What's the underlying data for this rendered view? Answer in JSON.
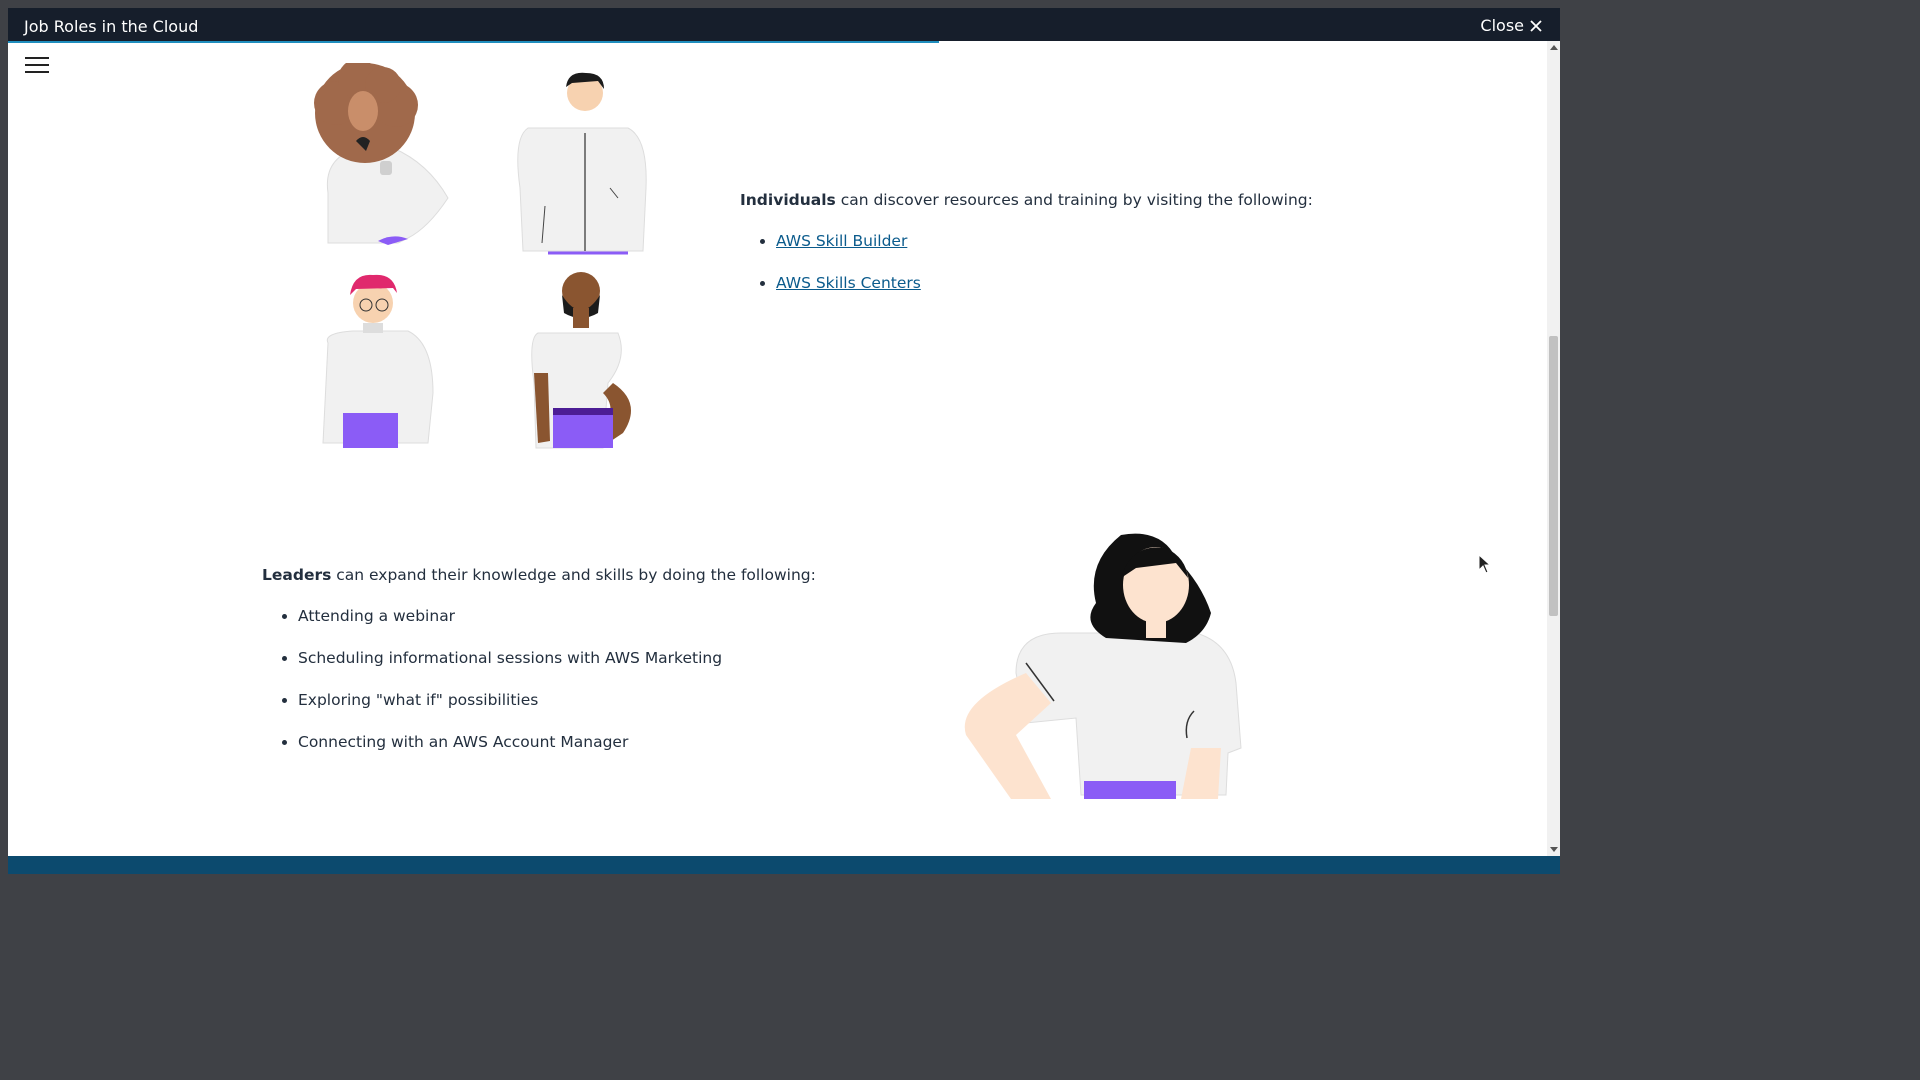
{
  "window": {
    "title": "Job Roles in the Cloud",
    "close_label": "Close",
    "progress_fraction": 0.6
  },
  "individuals": {
    "lead_bold": "Individuals",
    "lead_rest": " can discover resources and training by visiting the following:",
    "links": [
      "AWS Skill Builder",
      "AWS Skills Centers"
    ]
  },
  "leaders": {
    "lead_bold": "Leaders",
    "lead_rest": " can expand their knowledge and skills by doing the following:",
    "items": [
      "Attending a webinar",
      "Scheduling informational sessions with AWS Marketing",
      "Exploring \"what if\" possibilities",
      "Connecting with an AWS Account Manager"
    ]
  },
  "colors": {
    "titlebar": "#161e2b",
    "progress": "#1f8ebe",
    "footer": "#0c4a6e",
    "link": "#0b5b8c",
    "purple": "#8b5cf6"
  },
  "icons": {
    "menu": "hamburger-menu-icon",
    "close": "close-x-icon"
  }
}
